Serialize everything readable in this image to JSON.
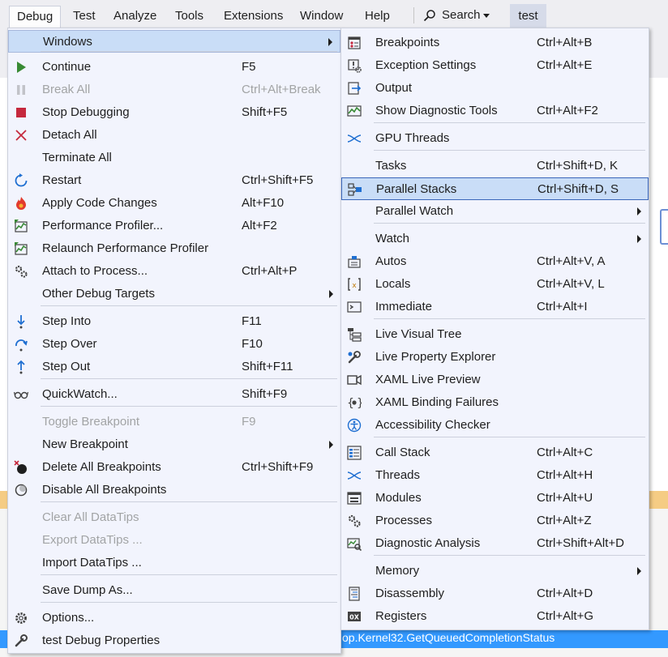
{
  "menubar": {
    "items": [
      "Debug",
      "Test",
      "Analyze",
      "Tools",
      "Extensions",
      "Window",
      "Help"
    ],
    "search_label": "Search",
    "solution_title": "test"
  },
  "background": {
    "selected_row_text": "op.Kernel32.GetQueuedCompletionStatus"
  },
  "debug_menu": {
    "items": [
      {
        "label": "Windows",
        "shortcut": "",
        "icon": "none",
        "submenu": true
      },
      {
        "label": "Continue",
        "shortcut": "F5",
        "icon": "play-icon"
      },
      {
        "label": "Break All",
        "shortcut": "Ctrl+Alt+Break",
        "icon": "pause-icon",
        "disabled": true
      },
      {
        "label": "Stop Debugging",
        "shortcut": "Shift+F5",
        "icon": "stop-icon"
      },
      {
        "label": "Detach All",
        "shortcut": "",
        "icon": "x-icon"
      },
      {
        "label": "Terminate All",
        "shortcut": "",
        "icon": "none"
      },
      {
        "label": "Restart",
        "shortcut": "Ctrl+Shift+F5",
        "icon": "restart-icon"
      },
      {
        "label": "Apply Code Changes",
        "shortcut": "Alt+F10",
        "icon": "flame-icon"
      },
      {
        "label": "Performance Profiler...",
        "shortcut": "Alt+F2",
        "icon": "profiler-icon"
      },
      {
        "label": "Relaunch Performance Profiler",
        "shortcut": "",
        "icon": "profiler-icon"
      },
      {
        "label": "Attach to Process...",
        "shortcut": "Ctrl+Alt+P",
        "icon": "gears-icon"
      },
      {
        "label": "Other Debug Targets",
        "shortcut": "",
        "icon": "none",
        "submenu": true
      },
      {
        "label": "Step Into",
        "shortcut": "F11",
        "icon": "step-into-icon"
      },
      {
        "label": "Step Over",
        "shortcut": "F10",
        "icon": "step-over-icon"
      },
      {
        "label": "Step Out",
        "shortcut": "Shift+F11",
        "icon": "step-out-icon"
      },
      {
        "label": "QuickWatch...",
        "shortcut": "Shift+F9",
        "icon": "glasses-icon"
      },
      {
        "label": "Toggle Breakpoint",
        "shortcut": "F9",
        "icon": "none",
        "disabled": true
      },
      {
        "label": "New Breakpoint",
        "shortcut": "",
        "icon": "none",
        "submenu": true
      },
      {
        "label": "Delete All Breakpoints",
        "shortcut": "Ctrl+Shift+F9",
        "icon": "delete-breakpoints-icon"
      },
      {
        "label": "Disable All Breakpoints",
        "shortcut": "",
        "icon": "disable-breakpoints-icon"
      },
      {
        "label": "Clear All DataTips",
        "shortcut": "",
        "icon": "none",
        "disabled": true
      },
      {
        "label": "Export DataTips ...",
        "shortcut": "",
        "icon": "none",
        "disabled": true
      },
      {
        "label": "Import DataTips ...",
        "shortcut": "",
        "icon": "none"
      },
      {
        "label": "Save Dump As...",
        "shortcut": "",
        "icon": "none"
      },
      {
        "label": "Options...",
        "shortcut": "",
        "icon": "gear-icon"
      },
      {
        "label": "test Debug Properties",
        "shortcut": "",
        "icon": "wrench-icon"
      }
    ]
  },
  "windows_submenu": {
    "items": [
      {
        "label": "Breakpoints",
        "shortcut": "Ctrl+Alt+B",
        "icon": "breakpoints-window-icon"
      },
      {
        "label": "Exception Settings",
        "shortcut": "Ctrl+Alt+E",
        "icon": "exception-settings-icon"
      },
      {
        "label": "Output",
        "shortcut": "",
        "icon": "output-icon"
      },
      {
        "label": "Show Diagnostic Tools",
        "shortcut": "Ctrl+Alt+F2",
        "icon": "diagnostic-tools-icon"
      },
      {
        "label": "GPU Threads",
        "shortcut": "",
        "icon": "gpu-threads-icon"
      },
      {
        "label": "Tasks",
        "shortcut": "Ctrl+Shift+D, K",
        "icon": "none"
      },
      {
        "label": "Parallel Stacks",
        "shortcut": "Ctrl+Shift+D, S",
        "icon": "parallel-stacks-icon"
      },
      {
        "label": "Parallel Watch",
        "shortcut": "",
        "icon": "none",
        "submenu": true
      },
      {
        "label": "Watch",
        "shortcut": "",
        "icon": "none",
        "submenu": true
      },
      {
        "label": "Autos",
        "shortcut": "Ctrl+Alt+V, A",
        "icon": "autos-icon"
      },
      {
        "label": "Locals",
        "shortcut": "Ctrl+Alt+V, L",
        "icon": "locals-icon"
      },
      {
        "label": "Immediate",
        "shortcut": "Ctrl+Alt+I",
        "icon": "immediate-icon"
      },
      {
        "label": "Live Visual Tree",
        "shortcut": "",
        "icon": "live-visual-tree-icon"
      },
      {
        "label": "Live Property Explorer",
        "shortcut": "",
        "icon": "live-property-explorer-icon"
      },
      {
        "label": "XAML Live Preview",
        "shortcut": "",
        "icon": "xaml-live-preview-icon"
      },
      {
        "label": "XAML Binding Failures",
        "shortcut": "",
        "icon": "xaml-binding-failures-icon"
      },
      {
        "label": "Accessibility Checker",
        "shortcut": "",
        "icon": "accessibility-icon"
      },
      {
        "label": "Call Stack",
        "shortcut": "Ctrl+Alt+C",
        "icon": "call-stack-icon"
      },
      {
        "label": "Threads",
        "shortcut": "Ctrl+Alt+H",
        "icon": "threads-icon"
      },
      {
        "label": "Modules",
        "shortcut": "Ctrl+Alt+U",
        "icon": "modules-icon"
      },
      {
        "label": "Processes",
        "shortcut": "Ctrl+Alt+Z",
        "icon": "processes-icon"
      },
      {
        "label": "Diagnostic Analysis",
        "shortcut": "Ctrl+Shift+Alt+D",
        "icon": "diagnostic-analysis-icon"
      },
      {
        "label": "Memory",
        "shortcut": "",
        "icon": "none",
        "submenu": true
      },
      {
        "label": "Disassembly",
        "shortcut": "Ctrl+Alt+D",
        "icon": "disassembly-icon"
      },
      {
        "label": "Registers",
        "shortcut": "Ctrl+Alt+G",
        "icon": "registers-icon"
      }
    ]
  }
}
